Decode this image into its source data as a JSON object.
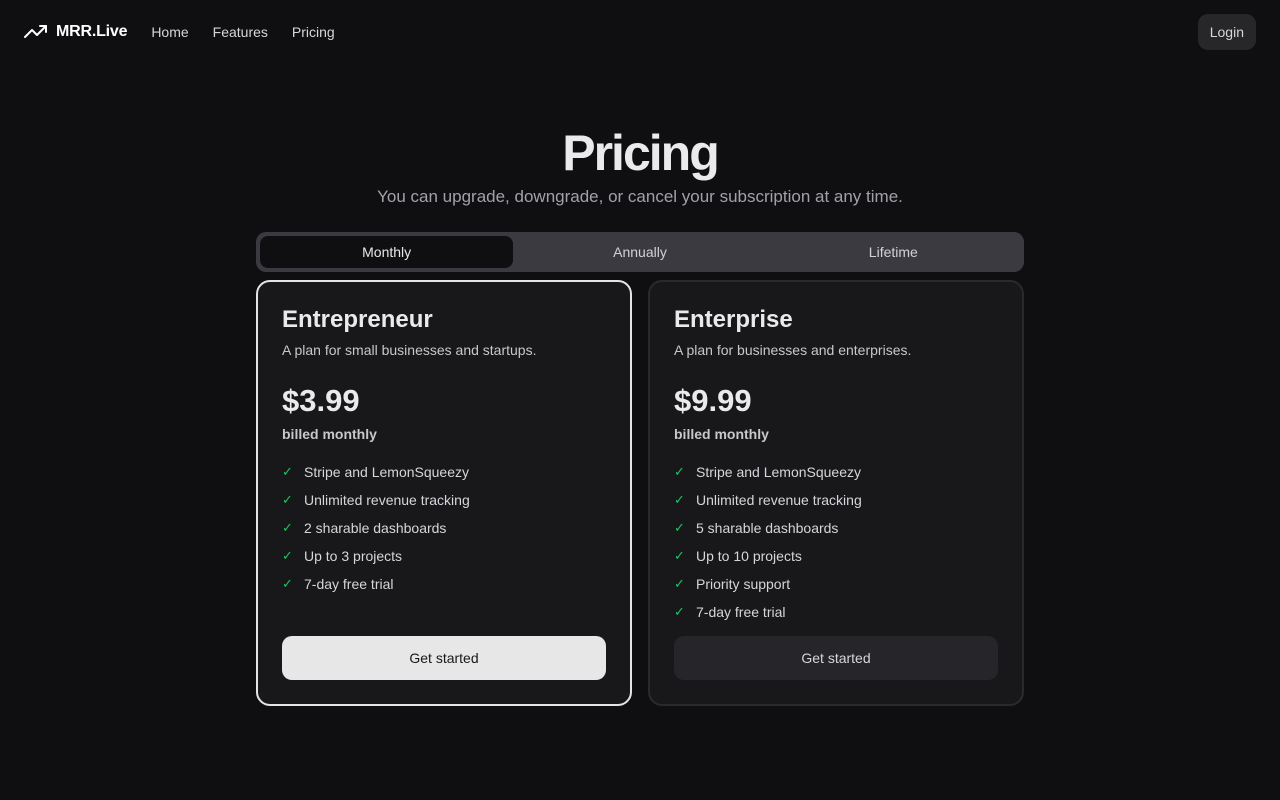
{
  "nav": {
    "brand": "MRR.Live",
    "links": [
      "Home",
      "Features",
      "Pricing"
    ],
    "login_label": "Login"
  },
  "hero": {
    "title": "Pricing",
    "subtitle": "You can upgrade, downgrade, or cancel your subscription at any time."
  },
  "billing_toggle": {
    "options": [
      "Monthly",
      "Annually",
      "Lifetime"
    ],
    "selected": "Monthly"
  },
  "plans": [
    {
      "name": "Entrepreneur",
      "description": "A plan for small businesses and startups.",
      "price": "$3.99",
      "billing": "billed monthly",
      "features": [
        "Stripe and LemonSqueezy",
        "Unlimited revenue tracking",
        "2 sharable dashboards",
        "Up to 3 projects",
        "7-day free trial"
      ],
      "cta": "Get started"
    },
    {
      "name": "Enterprise",
      "description": "A plan for businesses and enterprises.",
      "price": "$9.99",
      "billing": "billed monthly",
      "features": [
        "Stripe and LemonSqueezy",
        "Unlimited revenue tracking",
        "5 sharable dashboards",
        "Up to 10 projects",
        "Priority support",
        "7-day free trial"
      ],
      "cta": "Get started"
    }
  ],
  "icons": {
    "brand": "trending-up-icon",
    "feature": "check-icon"
  },
  "colors": {
    "background": "#0f0f11",
    "card": "#18181b",
    "check": "#22c55e",
    "accent_button": "#e7e7e8"
  }
}
